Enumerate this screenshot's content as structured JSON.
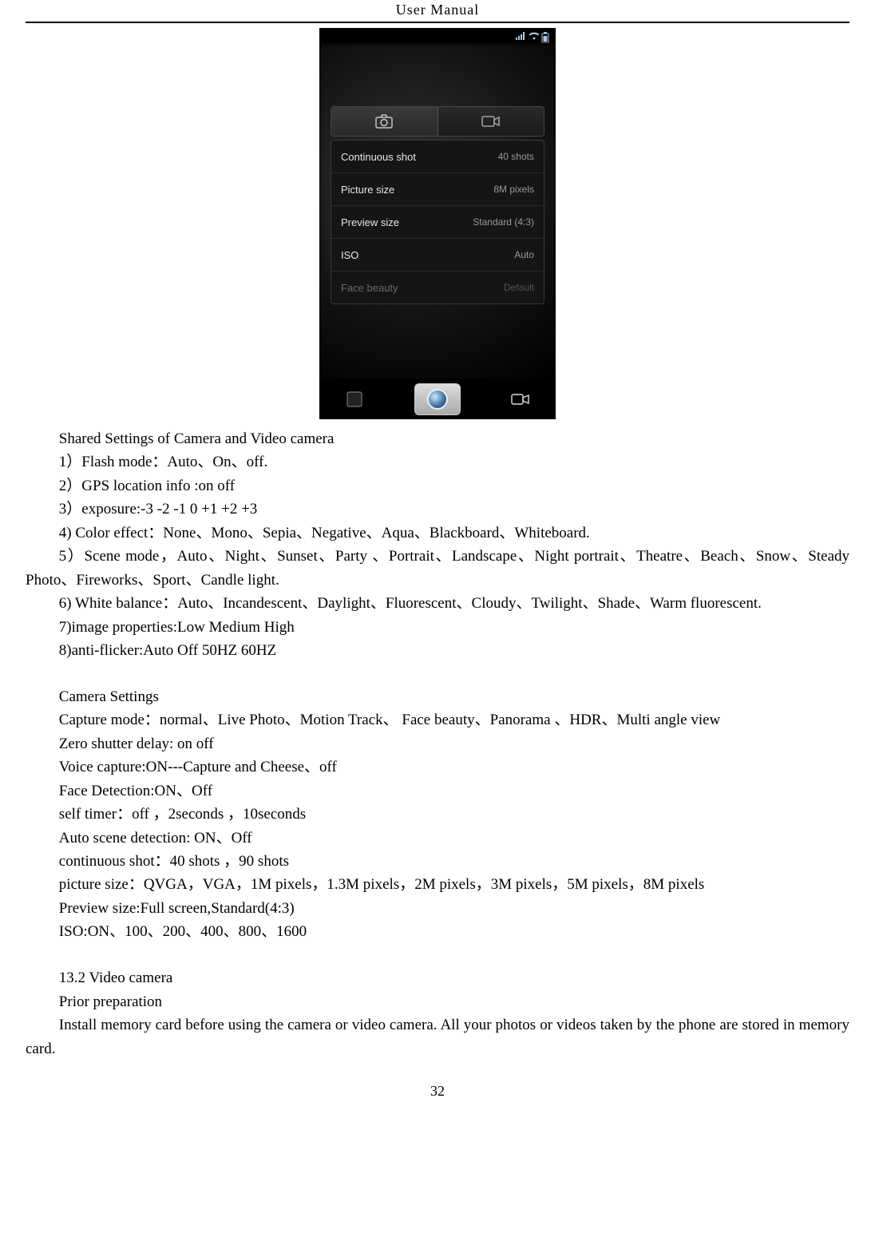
{
  "header": {
    "title": "User    Manual"
  },
  "page_number": "32",
  "screenshot": {
    "tabs": {
      "camera_tab": "camera-icon",
      "video_tab": "video-icon"
    },
    "settings": [
      {
        "label": "Continuous shot",
        "value": "40 shots",
        "dim": false
      },
      {
        "label": "Picture size",
        "value": "8M pixels",
        "dim": false
      },
      {
        "label": "Preview size",
        "value": "Standard (4:3)",
        "dim": false
      },
      {
        "label": "ISO",
        "value": "Auto",
        "dim": false
      },
      {
        "label": "Face beauty",
        "value": "Default",
        "dim": true
      }
    ]
  },
  "paragraphs": [
    "Shared Settings of Camera and Video camera",
    "1）Flash mode：Auto、On、off.",
    " 2）GPS location info :on      off",
    "3）exposure:-3    -2    -1    0    +1    +2    +3",
    "4)    Color effect：None、Mono、Sepia、Negative、Aqua、Blackboard、Whiteboard.",
    "5）Scene mode，Auto、Night、Sunset、Party  、Portrait、Landscape、Night portrait、Theatre、Beach、Snow、Steady Photo、Fireworks、Sport、Candle light.",
    "6) White balance：Auto、Incandescent、Daylight、Fluorescent、Cloudy、Twilight、Shade、Warm fluorescent.",
    "7)image properties:Low    Medium    High",
    "8)anti-flicker:Auto    Off    50HZ    60HZ"
  ],
  "paragraphs2": [
    "Camera Settings",
    "Capture mode：normal、Live Photo、Motion Track、  Face beauty、Panorama    、HDR、Multi angle view",
    "Zero shutter delay: on    off",
    "Voice capture:ON---Capture and Cheese、off",
    "Face Detection:ON、Off",
    "self timer：off  ，2seconds  ，10seconds",
    "Auto scene detection: ON、Off",
    "continuous shot：40 shots  ，90 shots",
    "picture size：QVGA，VGA，1M pixels，1.3M pixels，2M pixels，3M pixels，5M pixels，8M pixels",
    "Preview size:Full screen,Standard(4:3)",
    "ISO:ON、100、200、400、800、1600"
  ],
  "paragraphs3": [
    "13.2    Video camera",
    "Prior preparation",
    "Install memory card before using the camera or video camera. All your photos or videos taken by the phone are stored in memory card."
  ]
}
